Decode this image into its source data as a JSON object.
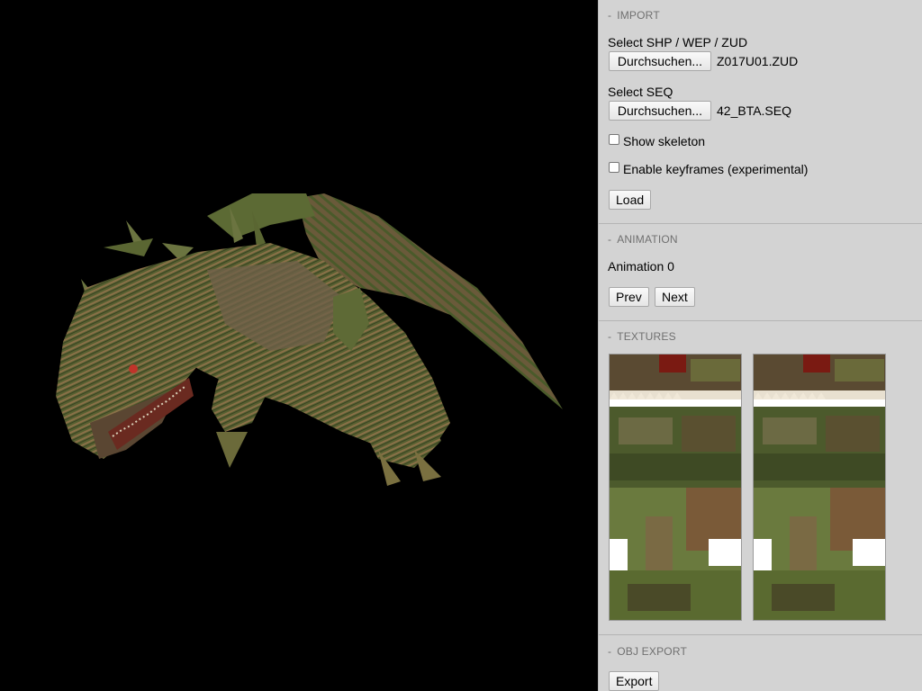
{
  "viewport": {
    "scene": "3d-model-render",
    "background_color": "#000000",
    "model_palette": [
      "#5f6a3a",
      "#7a6a4a",
      "#3f4a2a",
      "#9a7a52",
      "#c0342a"
    ]
  },
  "import": {
    "header_dash": "-",
    "header": "IMPORT",
    "shp_label": "Select SHP / WEP / ZUD",
    "shp_button": "Durchsuchen...",
    "shp_file": "Z017U01.ZUD",
    "seq_label": "Select SEQ",
    "seq_button": "Durchsuchen...",
    "seq_file": "42_BTA.SEQ",
    "skeleton_label": "Show skeleton",
    "skeleton_checked": false,
    "keyframes_label": "Enable keyframes (experimental)",
    "keyframes_checked": false,
    "load_button": "Load"
  },
  "animation": {
    "header_dash": "-",
    "header": "ANIMATION",
    "current": "Animation 0",
    "prev_button": "Prev",
    "next_button": "Next"
  },
  "textures": {
    "header_dash": "-",
    "header": "TEXTURES",
    "count": 2
  },
  "obj_export": {
    "header_dash": "-",
    "header": "OBJ EXPORT",
    "export_button": "Export"
  },
  "colors": {
    "panel_bg": "#d3d3d3",
    "header_text": "#707070",
    "divider": "#b4b4b4"
  }
}
